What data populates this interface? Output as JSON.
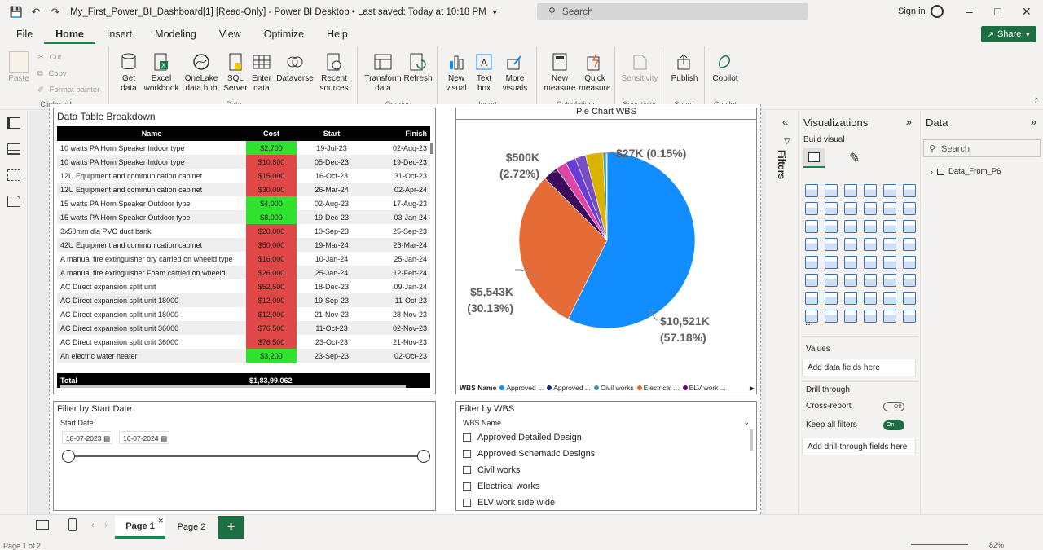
{
  "titlebar": {
    "doc_title": "My_First_Power_BI_Dashboard[1] [Read-Only] - Power BI Desktop • Last saved: Today at 10:18 PM",
    "search_placeholder": "Search",
    "signin": "Sign in"
  },
  "menu": [
    "File",
    "Home",
    "Insert",
    "Modeling",
    "View",
    "Optimize",
    "Help"
  ],
  "menu_active": "Home",
  "share_label": "Share",
  "ribbon": {
    "clipboard": {
      "label": "Clipboard",
      "paste": "Paste",
      "cut": "Cut",
      "copy": "Copy",
      "format_painter": "Format painter"
    },
    "data": {
      "label": "Data",
      "buttons": [
        {
          "l1": "Get",
          "l2": "data"
        },
        {
          "l1": "Excel",
          "l2": "workbook"
        },
        {
          "l1": "OneLake",
          "l2": "data hub"
        },
        {
          "l1": "SQL",
          "l2": "Server"
        },
        {
          "l1": "Enter",
          "l2": "data"
        },
        {
          "l1": "Dataverse",
          "l2": ""
        },
        {
          "l1": "Recent",
          "l2": "sources"
        }
      ]
    },
    "queries": {
      "label": "Queries",
      "buttons": [
        {
          "l1": "Transform",
          "l2": "data"
        },
        {
          "l1": "Refresh",
          "l2": ""
        }
      ]
    },
    "insert": {
      "label": "Insert",
      "buttons": [
        {
          "l1": "New",
          "l2": "visual"
        },
        {
          "l1": "Text",
          "l2": "box"
        },
        {
          "l1": "More",
          "l2": "visuals"
        }
      ]
    },
    "calculations": {
      "label": "Calculations",
      "buttons": [
        {
          "l1": "New",
          "l2": "measure"
        },
        {
          "l1": "Quick",
          "l2": "measure"
        }
      ]
    },
    "sensitivity": {
      "label": "Sensitivity",
      "buttons": [
        {
          "l1": "Sensitivity",
          "l2": ""
        }
      ]
    },
    "share": {
      "label": "Share",
      "buttons": [
        {
          "l1": "Publish",
          "l2": ""
        }
      ]
    },
    "copilot": {
      "label": "Copilot",
      "buttons": [
        {
          "l1": "Copilot",
          "l2": ""
        }
      ]
    }
  },
  "table_visual": {
    "title": "Data Table Breakdown",
    "columns": [
      "Name",
      "Cost",
      "Start",
      "Finish"
    ],
    "rows": [
      {
        "name": "10 watts PA Horn Speaker Indoor type",
        "cost": "$2,700",
        "start": "19-Jul-23",
        "finish": "02-Aug-23",
        "status": "green"
      },
      {
        "name": "10 watts PA Horn Speaker Indoor type",
        "cost": "$10,800",
        "start": "05-Dec-23",
        "finish": "19-Dec-23",
        "status": "red"
      },
      {
        "name": "12U Equipment and communication cabinet",
        "cost": "$15,000",
        "start": "16-Oct-23",
        "finish": "31-Oct-23",
        "status": "red"
      },
      {
        "name": "12U Equipment and communication cabinet",
        "cost": "$30,000",
        "start": "26-Mar-24",
        "finish": "02-Apr-24",
        "status": "red"
      },
      {
        "name": "15 watts PA Horn Speaker Outdoor type",
        "cost": "$4,000",
        "start": "02-Aug-23",
        "finish": "17-Aug-23",
        "status": "green"
      },
      {
        "name": "15 watts PA Horn Speaker Outdoor type",
        "cost": "$8,000",
        "start": "19-Dec-23",
        "finish": "03-Jan-24",
        "status": "green"
      },
      {
        "name": "3x50mm dia PVC duct bank",
        "cost": "$20,000",
        "start": "10-Sep-23",
        "finish": "25-Sep-23",
        "status": "red"
      },
      {
        "name": "42U Equipment and communication cabinet",
        "cost": "$50,000",
        "start": "19-Mar-24",
        "finish": "26-Mar-24",
        "status": "red"
      },
      {
        "name": "A manual fire extinguisher dry carried on wheeld type",
        "cost": "$16,000",
        "start": "10-Jan-24",
        "finish": "25-Jan-24",
        "status": "red"
      },
      {
        "name": "A manual fire extinguisher Foam carried on wheeld",
        "cost": "$26,000",
        "start": "25-Jan-24",
        "finish": "12-Feb-24",
        "status": "red"
      },
      {
        "name": "AC Direct expansion split unit",
        "cost": "$52,500",
        "start": "18-Dec-23",
        "finish": "09-Jan-24",
        "status": "red"
      },
      {
        "name": "AC Direct expansion split unit 18000",
        "cost": "$12,000",
        "start": "19-Sep-23",
        "finish": "11-Oct-23",
        "status": "red"
      },
      {
        "name": "AC Direct expansion split unit 18000",
        "cost": "$12,000",
        "start": "21-Nov-23",
        "finish": "28-Nov-23",
        "status": "red"
      },
      {
        "name": "AC Direct expansion split unit 36000",
        "cost": "$76,500",
        "start": "11-Oct-23",
        "finish": "02-Nov-23",
        "status": "red"
      },
      {
        "name": "AC Direct expansion split unit 36000",
        "cost": "$76,500",
        "start": "23-Oct-23",
        "finish": "21-Nov-23",
        "status": "red"
      },
      {
        "name": "An electric water heater",
        "cost": "$3,200",
        "start": "23-Sep-23",
        "finish": "02-Oct-23",
        "status": "green"
      }
    ],
    "total_label": "Total",
    "total_cost": "$1,83,99,062",
    "colors": {
      "green": "#2ee22e",
      "red": "#e04848"
    }
  },
  "pie_visual": {
    "title": "Pie Chart WBS",
    "legend_title": "WBS Name",
    "legend_items": [
      "Approved ...",
      "Approved ...",
      "Civil works",
      "Electrical ...",
      "ELV work ..."
    ]
  },
  "chart_data": {
    "type": "pie",
    "title": "Pie Chart WBS",
    "categories": [
      "",
      "",
      "",
      "",
      "",
      "",
      "",
      "",
      ""
    ],
    "values": [
      57.18,
      30.13,
      2.72,
      2.0,
      1.9,
      1.9,
      3.2,
      0.6,
      0.15
    ],
    "slice_colors": [
      "#118dff",
      "#e66c37",
      "#3b0a5a",
      "#e044a7",
      "#6b3bd6",
      "#744ec2",
      "#d9b300",
      "#3c9b9b",
      "#e8927c"
    ],
    "data_labels": [
      {
        "line1": "$10,521K",
        "line2": "(57.18%)"
      },
      {
        "line1": "$5,543K",
        "line2": "(30.13%)"
      },
      {
        "line1": "$500K",
        "line2": "(2.72%)"
      },
      {
        "line1": "$27K (0.15%)",
        "line2": ""
      }
    ],
    "legend_colors": [
      "#118dff",
      "#12239e",
      "#3c9b9b",
      "#e66c37",
      "#6b007b"
    ]
  },
  "date_slicer": {
    "title": "Filter by Start Date",
    "field": "Start Date",
    "from": "18-07-2023",
    "to": "16-07-2024"
  },
  "wbs_slicer": {
    "title": "Filter by WBS",
    "field": "WBS Name",
    "items": [
      "Approved Detailed Design",
      "Approved Schematic Designs",
      "Civil works",
      "Electrical works",
      "ELV work side wide"
    ]
  },
  "filters_label": "Filters",
  "vis_pane": {
    "title": "Visualizations",
    "build_visual": "Build visual",
    "values": "Values",
    "add_fields": "Add data fields here",
    "drill_through": "Drill through",
    "cross_report": "Cross-report",
    "cross_report_state": "Off",
    "keep_filters": "Keep all filters",
    "keep_filters_state": "On",
    "add_drill": "Add drill-through fields here",
    "more": "..."
  },
  "data_pane": {
    "title": "Data",
    "search_placeholder": "Search",
    "table": "Data_From_P6"
  },
  "status": {
    "pages": [
      "Page 1",
      "Page 2"
    ],
    "page_info": "Page 1 of 2",
    "zoom": "82%"
  }
}
